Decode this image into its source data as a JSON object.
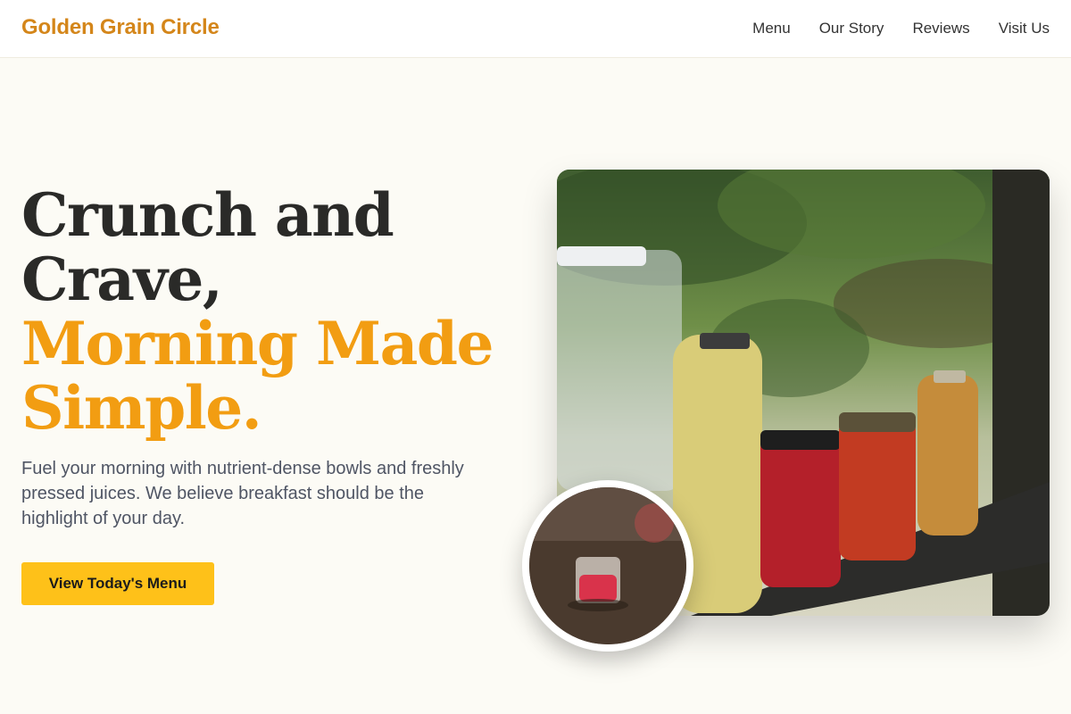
{
  "brand": {
    "name": "Golden Grain Circle"
  },
  "nav": {
    "items": [
      {
        "label": "Menu"
      },
      {
        "label": "Our Story"
      },
      {
        "label": "Reviews"
      },
      {
        "label": "Visit Us"
      }
    ]
  },
  "hero": {
    "title_line1": "Crunch and",
    "title_line2": "Crave,",
    "title_line3": "Morning Made",
    "title_line4": "Simple.",
    "subtitle": "Fuel your morning with nutrient-dense bowls and freshly pressed juices. We believe breakfast should be the highlight of your day.",
    "cta_label": "View Today's Menu"
  },
  "images": {
    "main": "glass jars of fruit-infused juices and water on an outdoor wooden shelf",
    "thumb": "small glass of red juice on a rustic wooden table"
  },
  "colors": {
    "brand": "#d4861a",
    "accent_text": "#f29d12",
    "button": "#fec119",
    "background": "#fcfbf5"
  }
}
